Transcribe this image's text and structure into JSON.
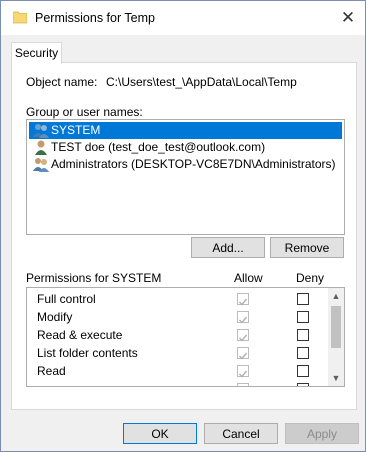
{
  "window": {
    "title": "Permissions for Temp",
    "close_label": "✕"
  },
  "tabs": [
    {
      "label": "Security"
    }
  ],
  "object": {
    "label": "Object name:",
    "value": "C:\\Users\\test_\\AppData\\Local\\Temp"
  },
  "group": {
    "label": "Group or user names:",
    "entries": [
      {
        "label": "SYSTEM",
        "icon": "group-users-icon",
        "selected": true
      },
      {
        "label": "TEST doe (test_doe_test@outlook.com)",
        "icon": "user-icon",
        "selected": false
      },
      {
        "label": "Administrators (DESKTOP-VC8E7DN\\Administrators)",
        "icon": "group-users-icon",
        "selected": false
      }
    ],
    "add_label": "Add...",
    "remove_label": "Remove"
  },
  "permissions": {
    "header": "Permissions for SYSTEM",
    "allow_header": "Allow",
    "deny_header": "Deny",
    "rows": [
      {
        "name": "Full control",
        "allow": true,
        "deny": false
      },
      {
        "name": "Modify",
        "allow": true,
        "deny": false
      },
      {
        "name": "Read & execute",
        "allow": true,
        "deny": false
      },
      {
        "name": "List folder contents",
        "allow": true,
        "deny": false
      },
      {
        "name": "Read",
        "allow": true,
        "deny": false
      },
      {
        "name": "",
        "allow": true,
        "deny": false
      }
    ]
  },
  "footer": {
    "ok_label": "OK",
    "cancel_label": "Cancel",
    "apply_label": "Apply"
  },
  "colors": {
    "selection": "#0078d7",
    "folder": "#f8d775"
  }
}
